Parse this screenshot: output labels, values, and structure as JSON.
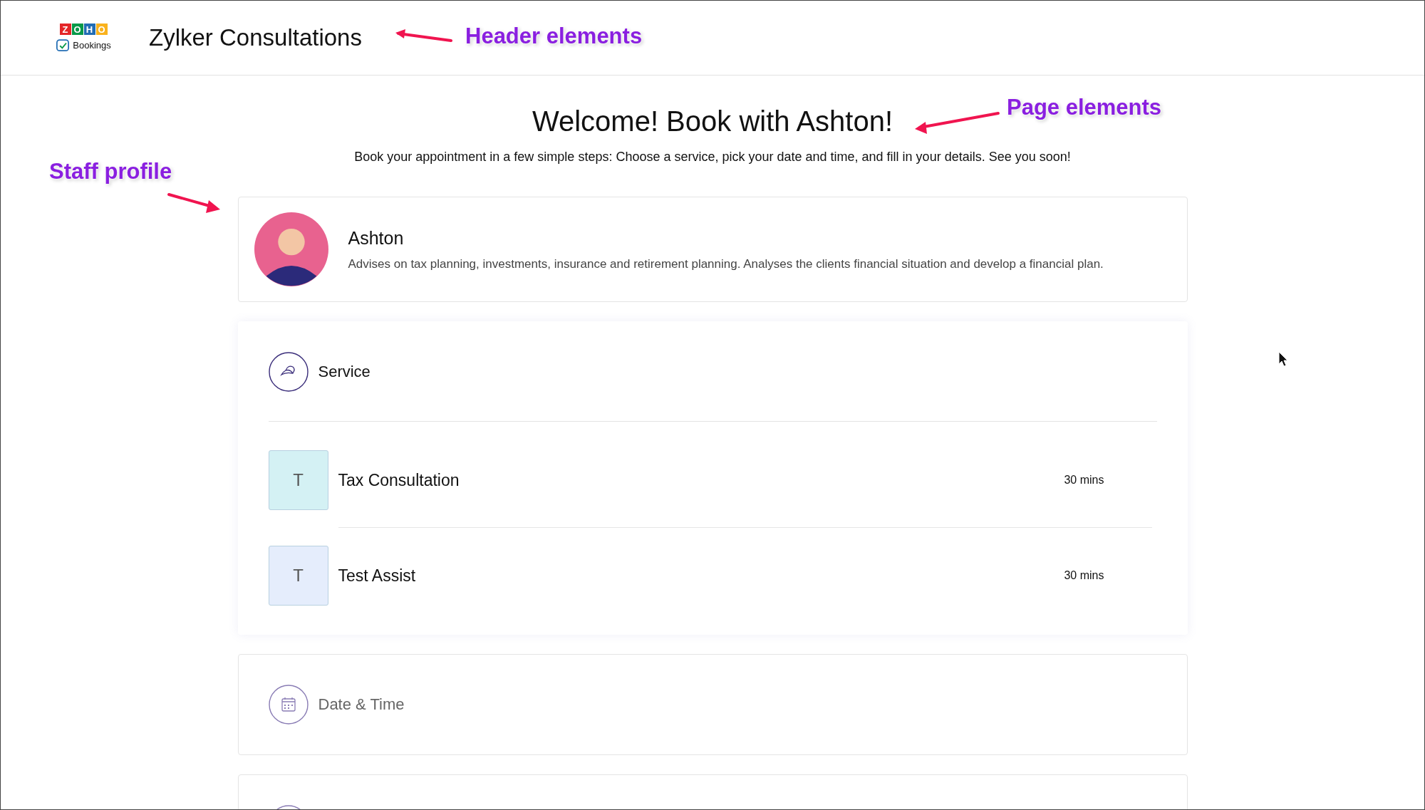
{
  "header": {
    "logo": {
      "letters": [
        {
          "char": "Z",
          "color": "#e42527"
        },
        {
          "char": "O",
          "color": "#089949"
        },
        {
          "char": "H",
          "color": "#226db4"
        },
        {
          "char": "O",
          "color": "#f9b21d"
        }
      ],
      "product": "Bookings"
    },
    "title": "Zylker Consultations"
  },
  "page": {
    "heading": "Welcome! Book with Ashton!",
    "intro": "Book your appointment in a few simple steps: Choose a service, pick your date and time, and fill in your details. See you soon!"
  },
  "staff": {
    "name": "Ashton",
    "description": "Advises on tax planning, investments, insurance and retirement planning. Analyses the clients financial situation and develop a financial plan."
  },
  "sections": [
    {
      "kind": "service",
      "title": "Service",
      "expanded": true,
      "items": [
        {
          "initial": "T",
          "name": "Tax Consultation",
          "duration": "30 mins",
          "color": "#d4f1f4"
        },
        {
          "initial": "T",
          "name": "Test Assist",
          "duration": "30 mins",
          "color": "#e5edfc"
        }
      ]
    },
    {
      "kind": "datetime",
      "title": "Date & Time",
      "expanded": false
    },
    {
      "kind": "step",
      "expanded": false
    }
  ],
  "annotations": [
    {
      "text": "Header elements"
    },
    {
      "text": "Page elements"
    },
    {
      "text": "Staff profile"
    }
  ]
}
